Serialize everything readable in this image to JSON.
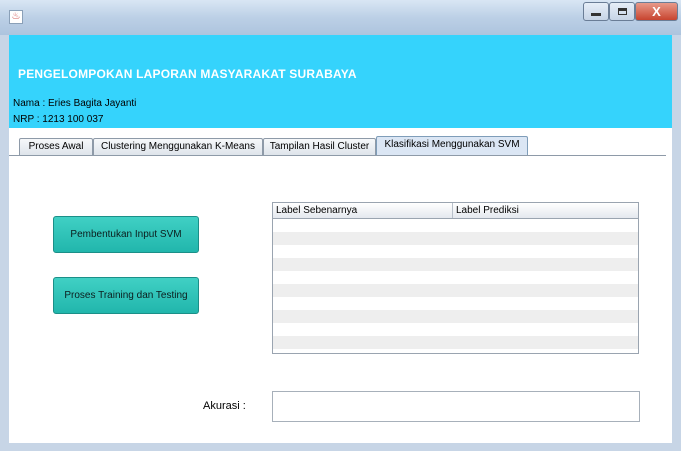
{
  "window": {
    "icon": "java-icon",
    "controls": {
      "close_glyph": "X"
    }
  },
  "header": {
    "title": "PENGELOMPOKAN LAPORAN MASYARAKAT SURABAYA",
    "name_line": "Nama : Eries Bagita Jayanti",
    "nrp_line": "NRP : 1213 100 037",
    "background": "#35d3fc"
  },
  "tabs": [
    {
      "label": "Proses Awal",
      "active": false
    },
    {
      "label": "Clustering Menggunakan K-Means",
      "active": false
    },
    {
      "label": "Tampilan Hasil Cluster",
      "active": false
    },
    {
      "label": "Klasifikasi Menggunakan SVM",
      "active": true
    }
  ],
  "buttons": {
    "svm_input": "Pembentukan Input SVM",
    "train_test": "Proses Training dan Testing",
    "color": "#2cc3b8"
  },
  "table": {
    "columns": [
      "Label Sebenarnya",
      "Label Prediksi"
    ],
    "rows": []
  },
  "accuracy": {
    "label": "Akurasi  :",
    "value": ""
  }
}
